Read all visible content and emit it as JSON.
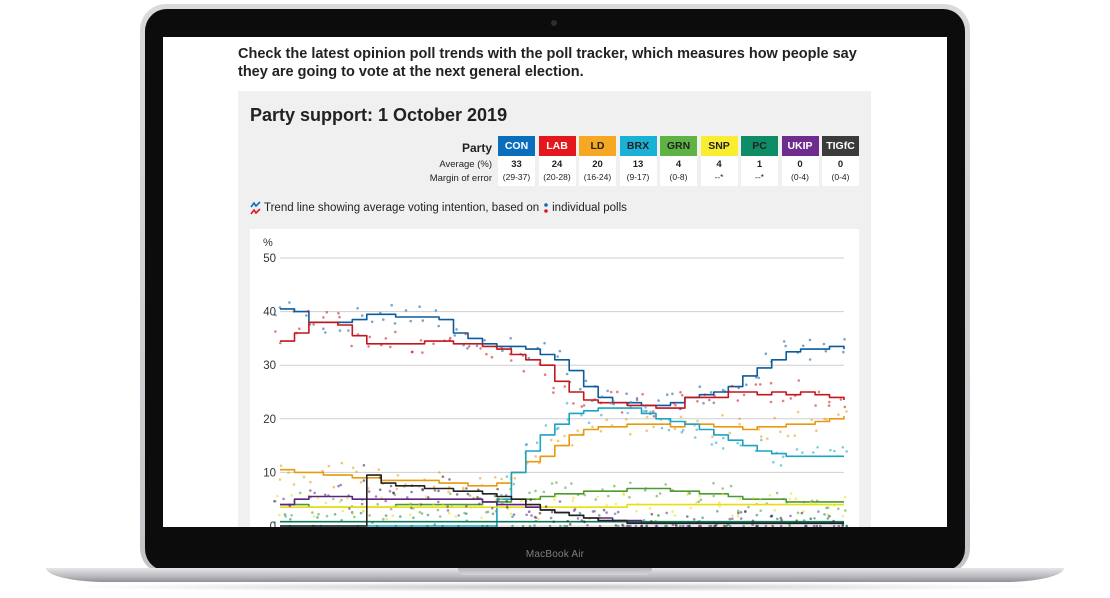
{
  "device": {
    "label": "MacBook Air"
  },
  "page": {
    "intro": "Check the latest opinion poll trends with the poll tracker, which measures how people say they are going to vote at the next general election.",
    "title": "Party support: 1 October 2019",
    "row_labels": {
      "party": "Party",
      "average": "Average (%)",
      "margin": "Margin of error"
    },
    "parties": [
      {
        "abbr": "CON",
        "average": "33",
        "margin": "(29-37)",
        "color": "#0a6ebd",
        "text_color": "#ffffff"
      },
      {
        "abbr": "LAB",
        "average": "24",
        "margin": "(20-28)",
        "color": "#e4171e",
        "text_color": "#ffffff"
      },
      {
        "abbr": "LD",
        "average": "20",
        "margin": "(16-24)",
        "color": "#f7a823",
        "text_color": "#222222"
      },
      {
        "abbr": "BRX",
        "average": "13",
        "margin": "(9-17)",
        "color": "#19b1d5",
        "text_color": "#222222"
      },
      {
        "abbr": "GRN",
        "average": "4",
        "margin": "(0-8)",
        "color": "#5fb344",
        "text_color": "#222222"
      },
      {
        "abbr": "SNP",
        "average": "4",
        "margin": "--*",
        "color": "#f8ee2f",
        "text_color": "#222222"
      },
      {
        "abbr": "PC",
        "average": "1",
        "margin": "--*",
        "color": "#0e8c66",
        "text_color": "#222222"
      },
      {
        "abbr": "UKIP",
        "average": "0",
        "margin": "(0-4)",
        "color": "#6e2d8e",
        "text_color": "#ffffff"
      },
      {
        "abbr": "TIGfC",
        "average": "0",
        "margin": "(0-4)",
        "color": "#3b3b3b",
        "text_color": "#ffffff"
      }
    ],
    "legend": {
      "part1": "Trend line showing average voting intention, based on",
      "part2": "individual polls"
    }
  },
  "chart_data": {
    "type": "line",
    "ylabel": "%",
    "ylim": [
      0,
      50
    ],
    "yticks": [
      0,
      10,
      20,
      30,
      40,
      50
    ],
    "grid": true,
    "series": [
      {
        "name": "CON",
        "color": "#0b5c9c",
        "values": [
          40.5,
          40,
          38,
          38,
          38,
          38.5,
          39.5,
          39.5,
          39,
          39,
          39,
          38.5,
          36,
          35,
          34,
          33.5,
          33.5,
          33,
          32,
          31,
          29,
          26,
          24,
          23,
          23,
          22.5,
          22.5,
          23,
          24,
          24.5,
          25,
          26,
          28,
          29.5,
          31,
          32.5,
          33,
          33,
          33.5,
          33
        ]
      },
      {
        "name": "LAB",
        "color": "#c4161c",
        "values": [
          34.5,
          36,
          38,
          38,
          37.5,
          35.5,
          34,
          34,
          34,
          34,
          34.5,
          34.5,
          34,
          34,
          33.5,
          33,
          32,
          31,
          30,
          27,
          25,
          23.5,
          23,
          23,
          22.5,
          22.5,
          22,
          22,
          24,
          24,
          24,
          25,
          25,
          24.5,
          25,
          24.5,
          25,
          24.5,
          24,
          23.5
        ]
      },
      {
        "name": "LD",
        "color": "#e8990d",
        "values": [
          10.5,
          10,
          10,
          9.5,
          9.5,
          9,
          9,
          8.5,
          8.5,
          8.5,
          8.5,
          8,
          8,
          7.5,
          7.5,
          8,
          10,
          12,
          13,
          15,
          17,
          18,
          18.5,
          18.5,
          19,
          19,
          19,
          18.5,
          19,
          19,
          18.5,
          18.5,
          18,
          18.5,
          18.5,
          19,
          19,
          19.5,
          20,
          20.5
        ]
      },
      {
        "name": "BRX",
        "color": "#1aa3c5",
        "values": [
          0,
          0,
          0,
          0,
          0,
          0,
          0,
          0,
          0,
          0,
          0,
          0,
          0,
          0,
          0,
          5,
          10,
          14,
          17,
          19,
          21,
          21.5,
          22,
          22,
          22,
          21,
          20,
          19.5,
          19,
          18,
          17,
          16,
          15,
          14,
          13.5,
          13,
          13,
          13,
          13,
          13
        ]
      },
      {
        "name": "GRN",
        "color": "#4e9a32",
        "values": [
          4,
          4,
          3.5,
          3.5,
          3.5,
          3.5,
          3.5,
          3.5,
          4,
          4,
          4,
          4,
          4,
          4,
          4.5,
          4.5,
          5,
          5,
          5.5,
          6,
          6,
          6.5,
          6.5,
          6.5,
          7,
          7,
          7,
          6.5,
          6.5,
          6,
          6,
          5.5,
          5,
          5,
          5,
          4.5,
          4.5,
          4.5,
          4.5,
          4.5
        ]
      },
      {
        "name": "SNP",
        "color": "#e8de10",
        "values": [
          3.5,
          3.5,
          3.5,
          3.5,
          3.5,
          3.5,
          3.5,
          3.5,
          3.5,
          3.5,
          3.5,
          3.5,
          3.5,
          3.5,
          3.5,
          3.5,
          3.5,
          3.5,
          3.5,
          3.5,
          3.5,
          3.5,
          3.5,
          3.5,
          4,
          4,
          4,
          4,
          4,
          4,
          4,
          4,
          4,
          4,
          4,
          4,
          4,
          4,
          4,
          4
        ]
      },
      {
        "name": "PC",
        "color": "#0e7a5a",
        "values": [
          0.8,
          0.8,
          0.8,
          0.8,
          0.8,
          0.8,
          0.8,
          0.8,
          0.8,
          0.8,
          0.8,
          0.8,
          0.8,
          0.8,
          0.8,
          0.8,
          0.8,
          0.8,
          0.8,
          0.8,
          0.8,
          0.8,
          0.8,
          0.8,
          0.8,
          0.8,
          0.8,
          0.8,
          0.8,
          0.8,
          0.8,
          0.8,
          0.8,
          0.8,
          0.8,
          0.8,
          0.8,
          0.8,
          0.8,
          0.8
        ]
      },
      {
        "name": "UKIP",
        "color": "#5e2381",
        "values": [
          4,
          5,
          5.5,
          5.5,
          5.5,
          5,
          5,
          5,
          5,
          5,
          5,
          5,
          5,
          5,
          4.5,
          4,
          4,
          3.5,
          3,
          2.5,
          2,
          1.5,
          1.5,
          1,
          1,
          0.5,
          0.5,
          0.5,
          0.5,
          0.5,
          0.5,
          0.5,
          0.5,
          0.5,
          0.5,
          0.5,
          0.5,
          0.5,
          0.5,
          0.5
        ]
      },
      {
        "name": "TIGfC",
        "color": "#222222",
        "values": [
          0,
          0,
          0,
          0,
          0,
          0,
          9.5,
          8,
          7.5,
          7.5,
          7,
          7,
          6.5,
          6.5,
          6,
          5.5,
          5,
          4,
          3,
          2.5,
          2,
          1.5,
          1,
          1,
          0.5,
          0.5,
          0.5,
          0.5,
          0.5,
          0.5,
          0.5,
          0.5,
          0.5,
          0.5,
          0.5,
          0.5,
          0.5,
          0.5,
          0.5,
          0.5
        ]
      }
    ]
  }
}
